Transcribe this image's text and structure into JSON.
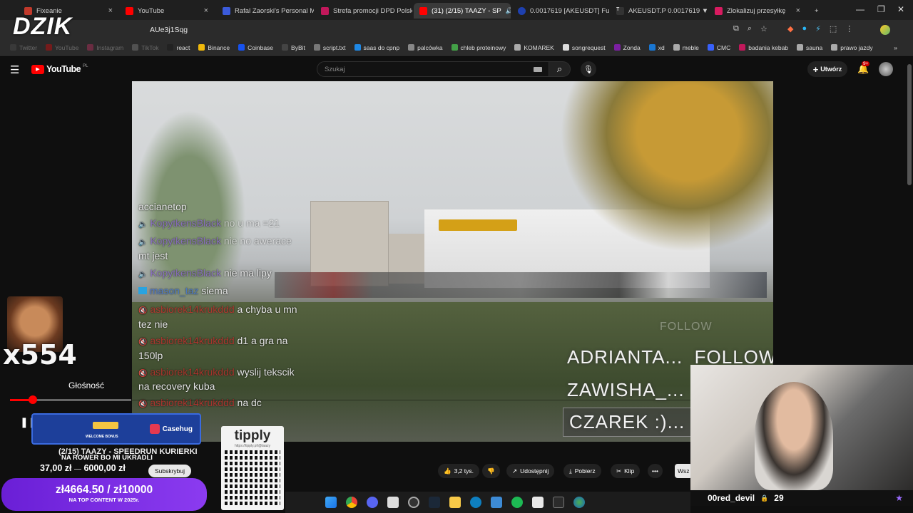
{
  "tabs": [
    {
      "title": "Fixeanie",
      "fav": "#c0392b"
    },
    {
      "title": "YouTube",
      "fav": "#ff0000"
    },
    {
      "title": "Rafal Zaorski's Personal M",
      "fav": "#3b5bdb"
    },
    {
      "title": "Strefa promocji DPD Polsk",
      "fav": "#c2185b"
    },
    {
      "title": "(31) (2/15) TAAZY - SP",
      "fav": "#ff0000"
    },
    {
      "title": "0.0017619 [AKEUSDT] Fut",
      "fav": "#1e40af"
    },
    {
      "title": "AKEUSDT.P 0.0017619 ▼",
      "fav": "#333333"
    },
    {
      "title": "Zlokalizuj przesyłkę",
      "fav": "#d81b60"
    }
  ],
  "url": "AUe3j1Sqg",
  "bookmarks": [
    {
      "label": "Twitter",
      "c": "#555"
    },
    {
      "label": "YouTube",
      "c": "#ff0000"
    },
    {
      "label": "Instagram",
      "c": "#e1306c"
    },
    {
      "label": "TikTok",
      "c": "#999"
    },
    {
      "label": "react",
      "c": "#222"
    },
    {
      "label": "Binance",
      "c": "#f0b90b"
    },
    {
      "label": "Coinbase",
      "c": "#1652f0"
    },
    {
      "label": "ByBit",
      "c": "#444"
    },
    {
      "label": "script.txt",
      "c": "#777"
    },
    {
      "label": "saas do cpnp",
      "c": "#1e88e5"
    },
    {
      "label": "palcówka",
      "c": "#888"
    },
    {
      "label": "chleb proteinowy",
      "c": "#43a047"
    },
    {
      "label": "KOMAREK",
      "c": "#aaa"
    },
    {
      "label": "songrequest",
      "c": "#ddd"
    },
    {
      "label": "Zonda",
      "c": "#7b1fa2"
    },
    {
      "label": "xd",
      "c": "#1976d2"
    },
    {
      "label": "meble",
      "c": "#aaa"
    },
    {
      "label": "CMC",
      "c": "#3861fb"
    },
    {
      "label": "badania kebab",
      "c": "#c2185b"
    },
    {
      "label": "sauna",
      "c": "#aaa"
    },
    {
      "label": "prawo jazdy",
      "c": "#aaa"
    }
  ],
  "youtube": {
    "logo_text": "YouTube",
    "region": "PL",
    "search_placeholder": "Szukaj",
    "create_label": "Utwórz",
    "notif_count": "9+"
  },
  "chat": [
    {
      "name": "",
      "msg": "accianetop",
      "color": ""
    },
    {
      "name": "KopytkensBlack",
      "msg": "no u ma =21",
      "color": "purple"
    },
    {
      "name": "KopytkensBlack",
      "msg": "nie no awerace",
      "color": "purple"
    },
    {
      "name": "",
      "msg": "mt jest",
      "color": ""
    },
    {
      "name": "KopytkensBlack",
      "msg": "nie ma lipy",
      "color": "purple"
    },
    {
      "name": "mason_taz",
      "msg": "siema",
      "color": "blue"
    },
    {
      "name": "asbiorek14krukddd",
      "msg": "a chyba u mn",
      "color": "red"
    },
    {
      "name": "",
      "msg": "tez nie",
      "color": ""
    },
    {
      "name": "asbiorek14krukddd",
      "msg": "d1 a gra na",
      "color": "red"
    },
    {
      "name": "",
      "msg": "150lp",
      "color": ""
    },
    {
      "name": "asbiorek14krukddd",
      "msg": "wyslij tekscik",
      "color": "red"
    },
    {
      "name": "",
      "msg": "na recovery kuba",
      "color": ""
    },
    {
      "name": "asbiorek14krukddd",
      "msg": "na dc",
      "color": ""
    }
  ],
  "alerts": {
    "a1": "ADRIANTA...",
    "a1b": "FOLLOW",
    "a2": "ZAWISHA_...",
    "a3": "CZAREK :)...",
    "a0": "FOLLOW"
  },
  "overlay": {
    "logo": "DZIK",
    "counter": "x554",
    "volume_label": "Głośność",
    "casehug": "Casehug",
    "welcome": "WELCOME BONUS",
    "stream_title": "(2/15) TAAZY - SPEEDRUN KURIERKI",
    "rower": "NA ROWER BO MI UKRADLI",
    "goal_current": "37,00 zł",
    "goal_target": "6000,00 zł",
    "subscribe": "Subskrybuj",
    "big_goal": "zł4664.50 / zł10000",
    "big_goal_sub": "NA TOP CONTENT W 2025r.",
    "tipply": "tipply",
    "tipply_url": "https://tipply.pl/@taazy",
    "cam_user": "00red_devil",
    "cam_count": "29"
  },
  "actions": {
    "likes": "3,2 tys.",
    "share": "Udostępnij",
    "download": "Pobierz",
    "clip": "Klip",
    "more": "•••",
    "wsz": "Wsz"
  },
  "icons": {
    "menu": "hamburger-icon",
    "search": "search-icon",
    "mic": "microphone-icon",
    "bell": "bell-icon"
  }
}
